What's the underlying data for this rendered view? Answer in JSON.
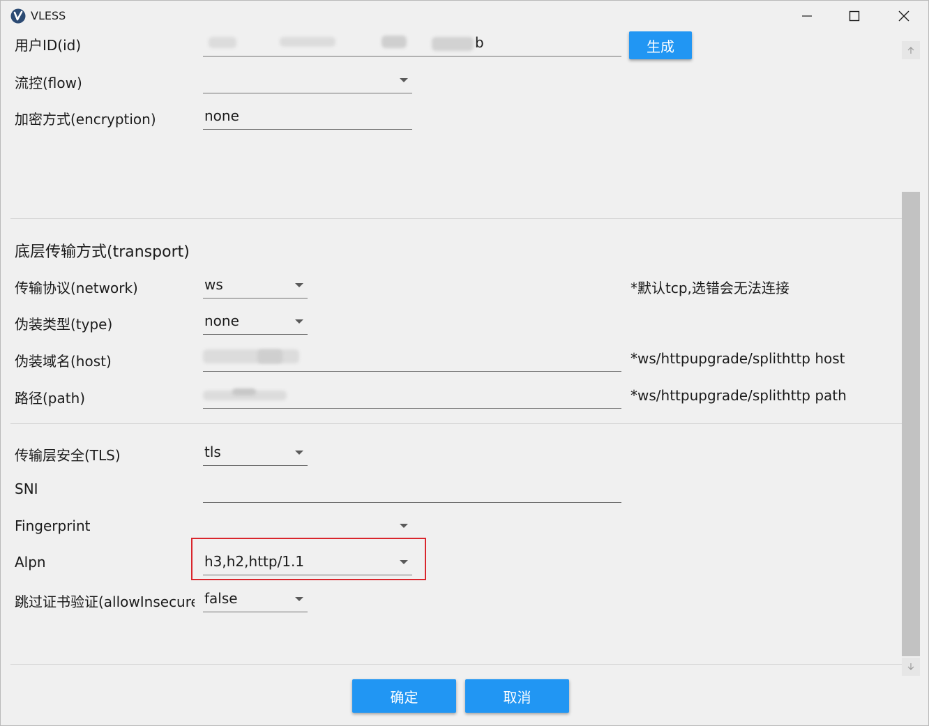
{
  "window": {
    "title": "VLESS"
  },
  "account": {
    "id_label": "用户ID(id)",
    "id_value_visible": "b",
    "generate_label": "生成",
    "flow_label": "流控(flow)",
    "flow_value": "",
    "encryption_label": "加密方式(encryption)",
    "encryption_value": "none"
  },
  "transport": {
    "section_title": "底层传输方式(transport)",
    "network_label": "传输协议(network)",
    "network_value": "ws",
    "network_hint": "*默认tcp,选错会无法连接",
    "type_label": "伪装类型(type)",
    "type_value": "none",
    "host_label": "伪装域名(host)",
    "host_hint": "*ws/httpupgrade/splithttp host",
    "path_label": "路径(path)",
    "path_hint": "*ws/httpupgrade/splithttp path"
  },
  "tls": {
    "tls_label": "传输层安全(TLS)",
    "tls_value": "tls",
    "sni_label": "SNI",
    "sni_value": "",
    "fingerprint_label": "Fingerprint",
    "fingerprint_value": "",
    "alpn_label": "Alpn",
    "alpn_value": "h3,h2,http/1.1",
    "insecure_label": "跳过证书验证(allowInsecure)",
    "insecure_value": "false"
  },
  "footer": {
    "ok_label": "确定",
    "cancel_label": "取消"
  },
  "colors": {
    "accent": "#2196f3",
    "highlight": "#d9262d"
  }
}
